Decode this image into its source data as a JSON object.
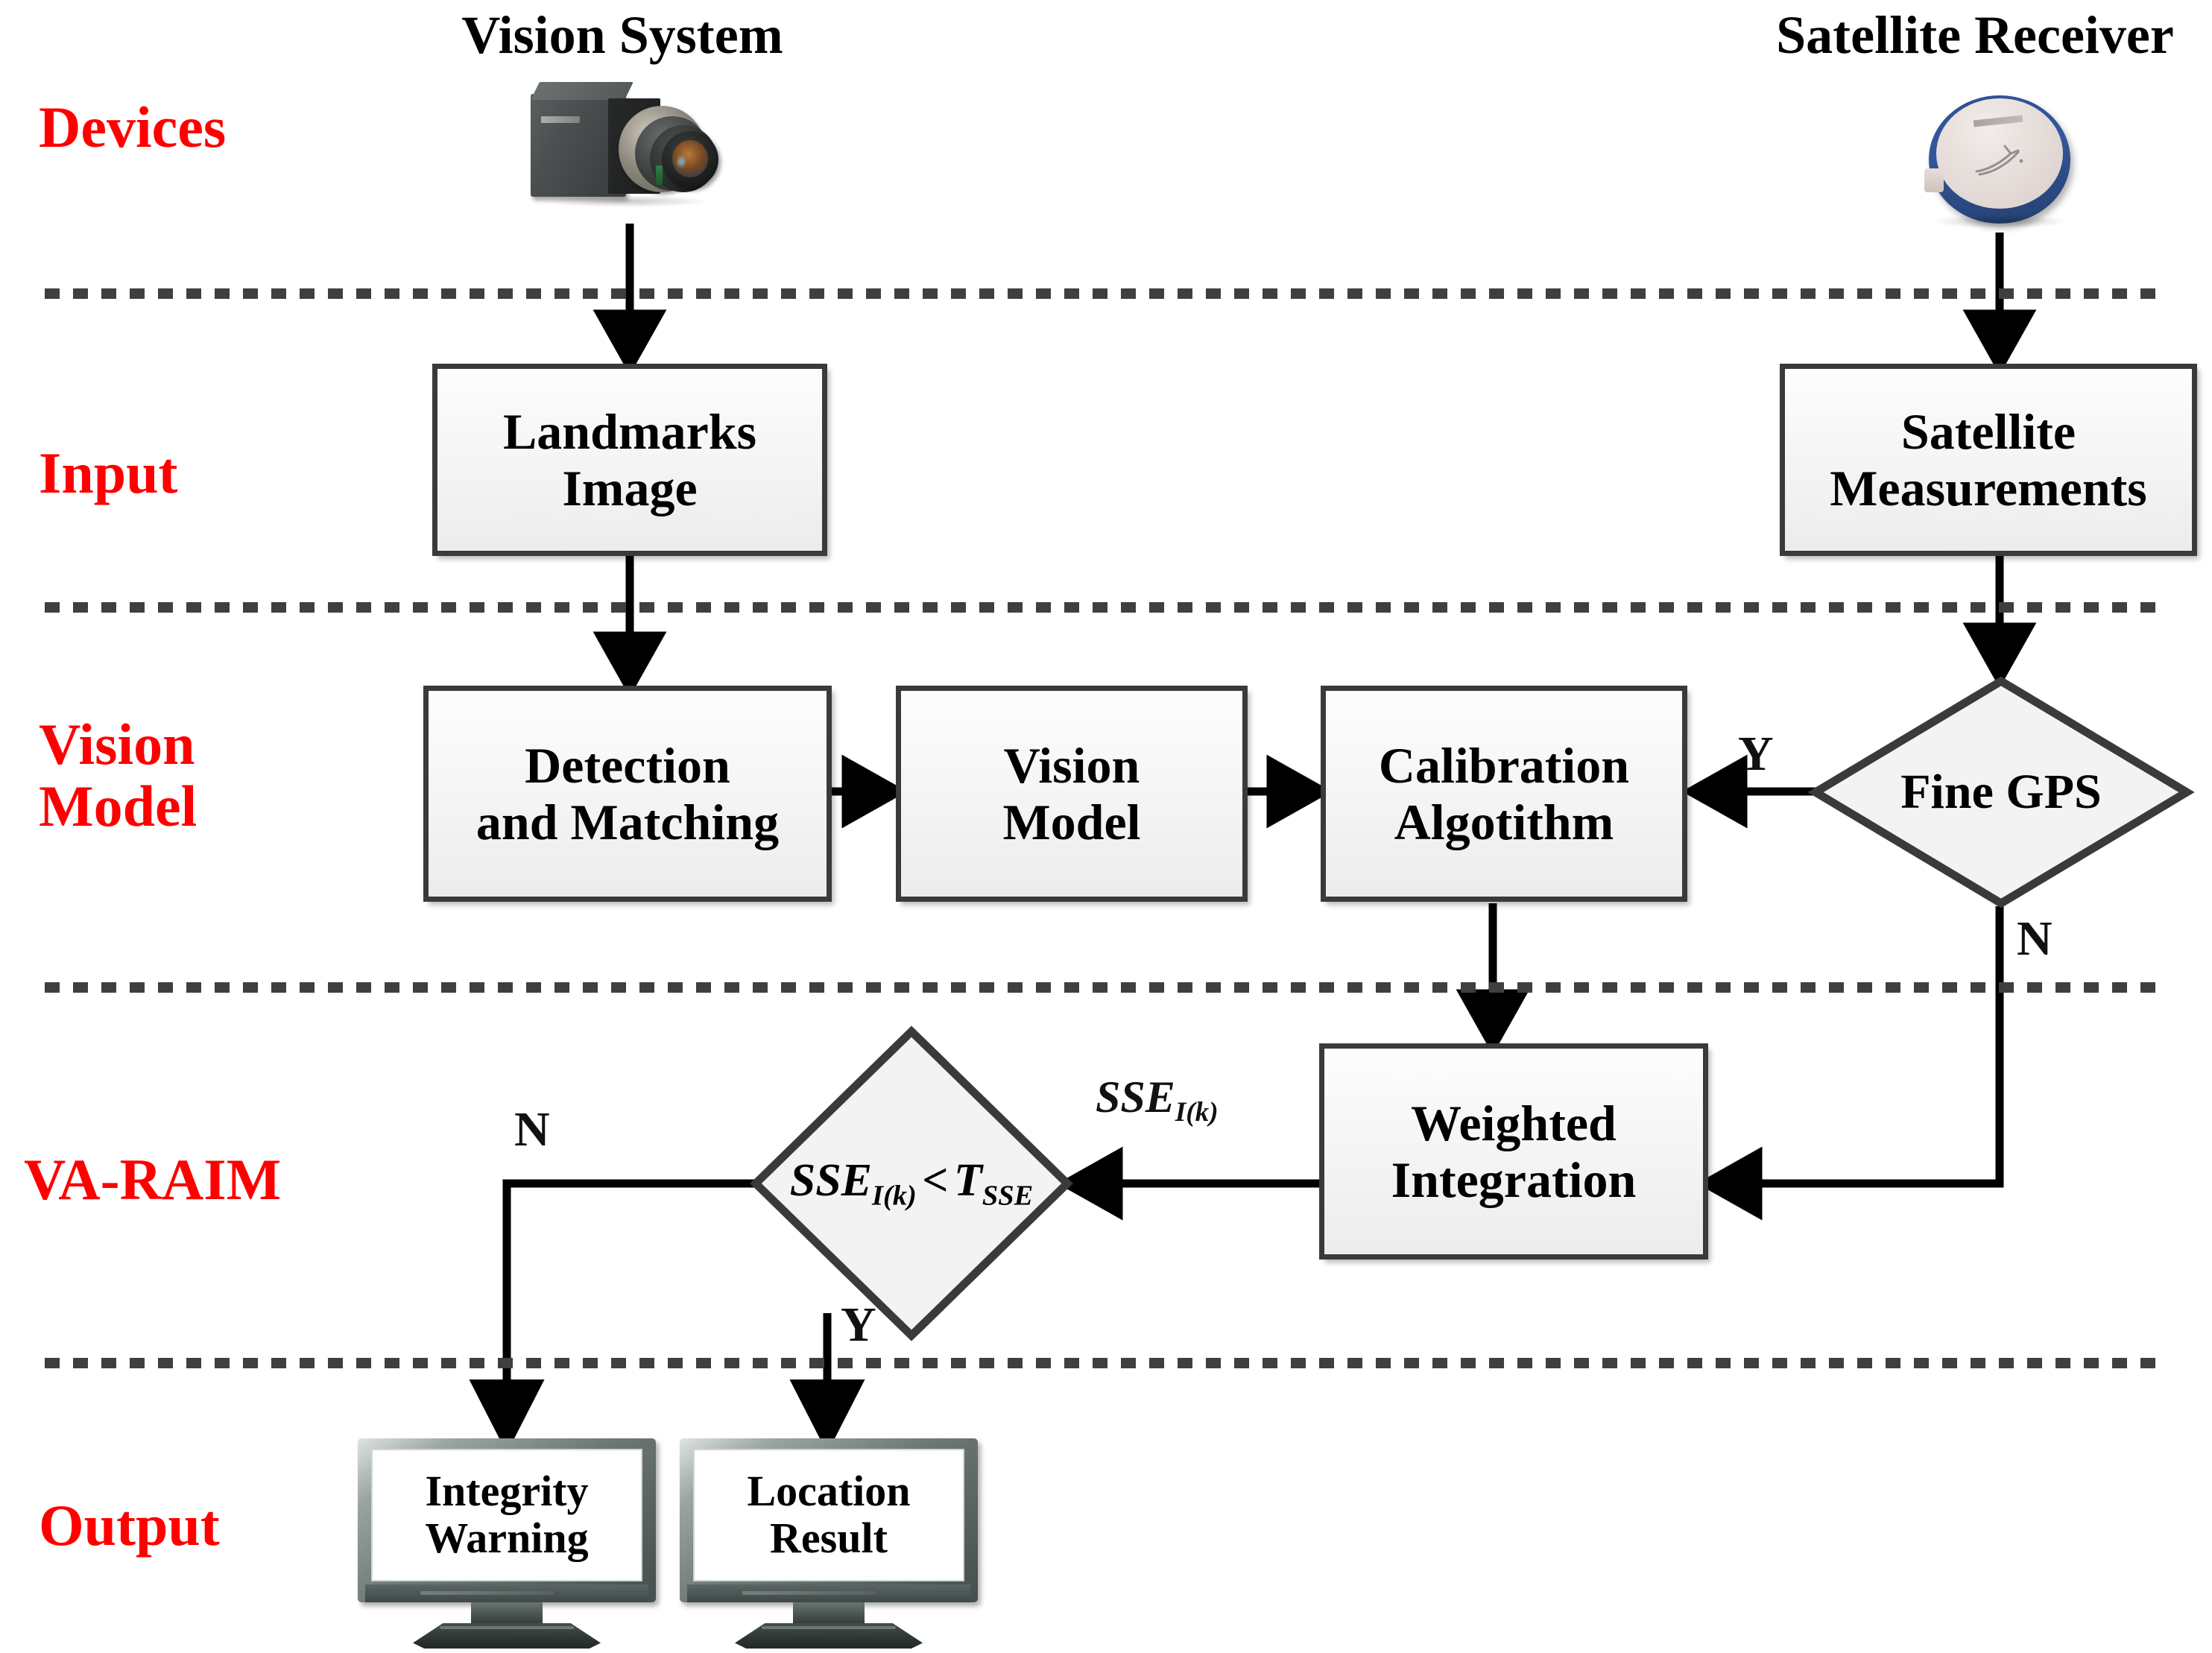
{
  "rows": [
    {
      "key": "devices",
      "label": "Devices"
    },
    {
      "key": "input",
      "label": "Input"
    },
    {
      "key": "vision_model",
      "label": "Vision\nModel"
    },
    {
      "key": "va_raim",
      "label": "VA-RAIM"
    },
    {
      "key": "output",
      "label": "Output"
    }
  ],
  "devices": [
    {
      "key": "vision_system",
      "title": "Vision System",
      "icon": "industrial-camera"
    },
    {
      "key": "satellite_receiver",
      "title": "Satellite Receiver",
      "icon": "gnss-antenna-disc"
    }
  ],
  "nodes": [
    {
      "key": "landmarks_image",
      "label": "Landmarks\nImage",
      "shape": "box"
    },
    {
      "key": "satellite_measurements",
      "label": "Satellite\nMeasurements",
      "shape": "box"
    },
    {
      "key": "detection_and_matching",
      "label": "Detection\nand Matching",
      "shape": "box"
    },
    {
      "key": "vision_model",
      "label": "Vision\nModel",
      "shape": "box"
    },
    {
      "key": "calibration_algorithm",
      "label": "Calibration\nAlgotithm",
      "shape": "box"
    },
    {
      "key": "weighted_integration",
      "label": "Weighted\nIntegration",
      "shape": "box"
    }
  ],
  "decisions": [
    {
      "key": "fine_gps",
      "label": "Fine GPS",
      "type": "text"
    },
    {
      "key": "sse_test",
      "type": "math",
      "math": {
        "lhs": "SSE",
        "lhs_sub": "I(k)",
        "op": "<",
        "rhs": "T",
        "rhs_sub": "SSE"
      }
    }
  ],
  "outputs": [
    {
      "key": "integrity_warning",
      "label": "Integrity\nWarning",
      "device": "lcd-monitor"
    },
    {
      "key": "location_result",
      "label": "Location\nResult",
      "device": "lcd-monitor"
    }
  ],
  "edge_labels": [
    {
      "key": "fine_gps_yes",
      "text": "Y"
    },
    {
      "key": "fine_gps_no",
      "text": "N"
    },
    {
      "key": "sse_no",
      "text": "N"
    },
    {
      "key": "sse_yes",
      "text": "Y"
    }
  ],
  "edge_math": [
    {
      "key": "sse_to_test",
      "lhs": "SSE",
      "lhs_sub": "I(k)"
    }
  ],
  "colors": {
    "row_label": "#ff0000",
    "node_border": "#3a3a3a",
    "node_fill": "#f4f4f4",
    "wire": "#000000",
    "divider": "#3f3f3f",
    "antenna_rim": "#2f4f8f",
    "antenna_top": "#e7dedb",
    "monitor_bezel": "#6d7876"
  }
}
